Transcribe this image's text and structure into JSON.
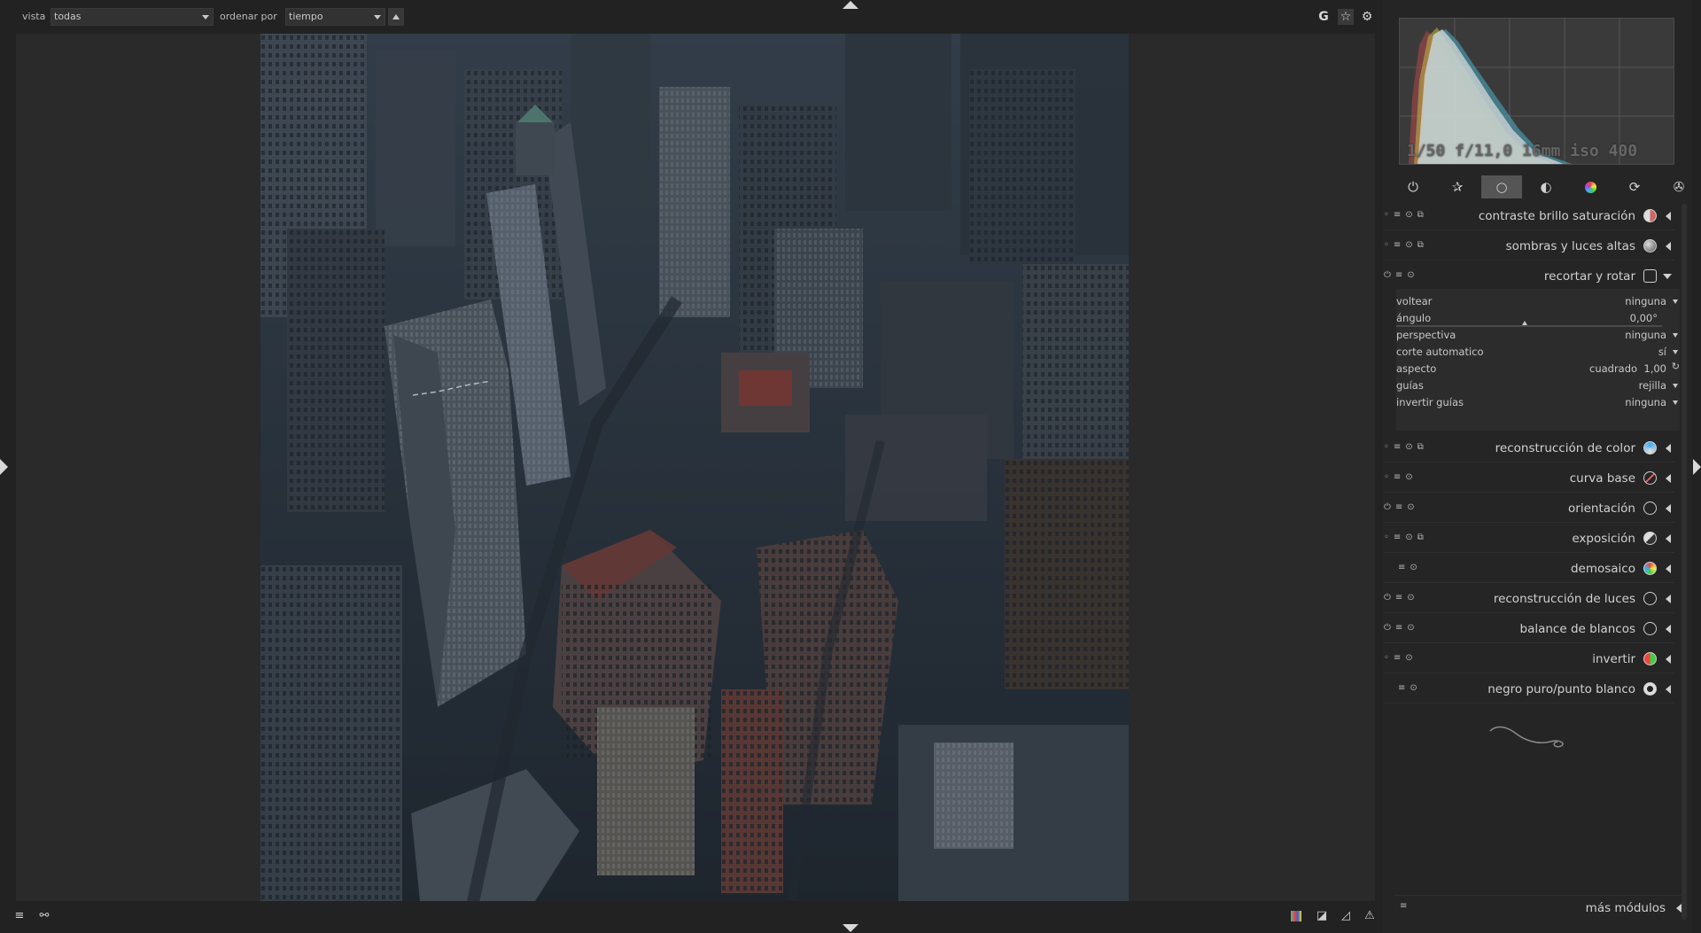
{
  "toolbar": {
    "view_label": "vista",
    "view_value": "todas",
    "sort_label": "ordenar por",
    "sort_value": "tiempo",
    "icons": [
      "grouping-g-icon",
      "star-overlay-icon",
      "preferences-gear-icon"
    ],
    "g_glyph": "G"
  },
  "histogram": {
    "info": "1/50 f/11,0 16mm iso 400"
  },
  "module_groups": [
    "power-active-icon",
    "favorites-star-icon",
    "base-circle-icon",
    "tone-circle-icon",
    "color-circle-icon",
    "correct-rotate-icon",
    "effects-aperture-icon"
  ],
  "active_group_index": 2,
  "modules": [
    {
      "name": "contraste brillo saturación",
      "icon": "contrast-icon",
      "expanded": false
    },
    {
      "name": "sombras y luces altas",
      "icon": "shadows-icon",
      "expanded": false
    },
    {
      "name": "recortar y rotar",
      "icon": "crop-icon",
      "expanded": true
    },
    {
      "name": "reconstrucción de color",
      "icon": "color-reconstruction-icon",
      "expanded": false
    },
    {
      "name": "curva base",
      "icon": "base-curve-icon",
      "expanded": false
    },
    {
      "name": "orientación",
      "icon": "orientation-icon",
      "expanded": false
    },
    {
      "name": "exposición",
      "icon": "exposure-icon",
      "expanded": false
    },
    {
      "name": "demosaico",
      "icon": "demosaic-icon",
      "expanded": false
    },
    {
      "name": "reconstrucción de luces",
      "icon": "highlight-reconstruction-icon",
      "expanded": false
    },
    {
      "name": "balance de blancos",
      "icon": "white-balance-icon",
      "expanded": false
    },
    {
      "name": "invertir",
      "icon": "invert-icon",
      "expanded": false
    },
    {
      "name": "negro puro/punto blanco",
      "icon": "rawprepare-icon",
      "expanded": false
    }
  ],
  "crop": {
    "voltear": {
      "label": "voltear",
      "value": "ninguna"
    },
    "angulo": {
      "label": "ángulo",
      "value": "0,00°"
    },
    "perspectiva": {
      "label": "perspectiva",
      "value": "ninguna"
    },
    "corte": {
      "label": "corte automatico",
      "value": "sí"
    },
    "aspecto": {
      "label": "aspecto",
      "value": "cuadrado  1,00"
    },
    "guias": {
      "label": "guías",
      "value": "rejilla"
    },
    "invertir": {
      "label": "invertir guías",
      "value": "ninguna"
    }
  },
  "more_modules": "más módulos",
  "colors": {
    "background": "#222222",
    "panel": "#252525",
    "active_group": "#555555",
    "text": "#d0d0d0"
  }
}
